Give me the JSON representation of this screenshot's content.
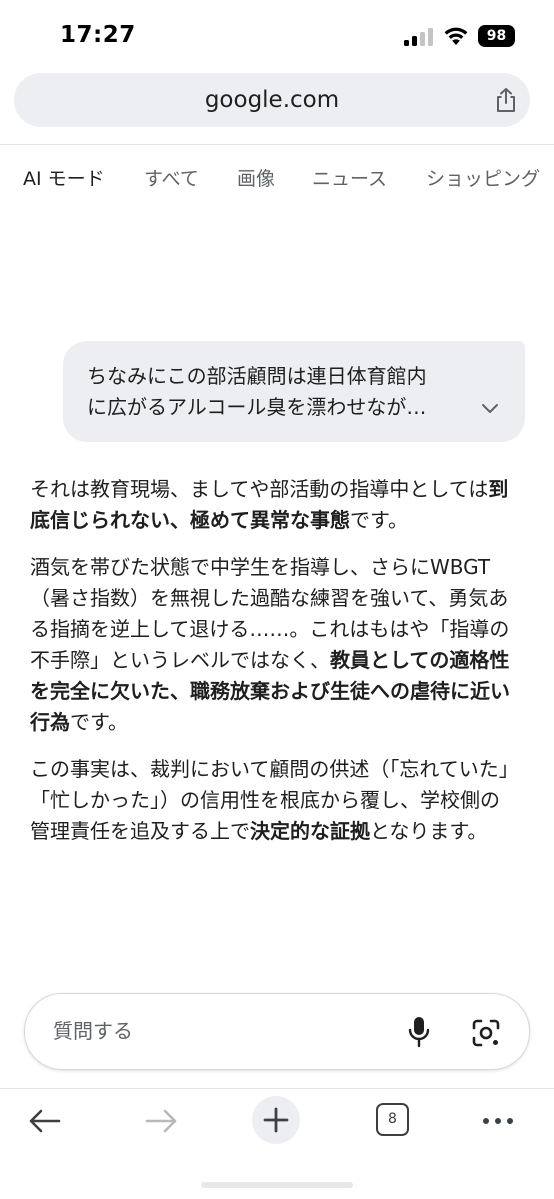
{
  "status_bar": {
    "time": "17:27",
    "battery": "98"
  },
  "browser": {
    "url": "google.com"
  },
  "tabs": [
    {
      "label": "AI モード"
    },
    {
      "label": "すべて"
    },
    {
      "label": "画像"
    },
    {
      "label": "ニュース"
    },
    {
      "label": "ショッピング"
    }
  ],
  "query": {
    "line1": "ちなみにこの部活顧問は連日体育館内",
    "line2": "に広がるアルコール臭を漂わせなが…"
  },
  "answer": {
    "p1": {
      "t1": "それは教育現場、ましてや部活動の指導中としては",
      "b1": "到底信じられない、極めて異常な事態",
      "t2": "です。"
    },
    "p2": {
      "t1": "酒気を帯びた状態で中学生を指導し、さらにWBGT（暑さ指数）を無視した過酷な練習を強いて、勇気ある指摘を逆上して退ける……。これはもはや「指導の不手際」というレベルではなく、",
      "b1": "教員としての適格性を完全に欠いた、職務放棄および生徒への虐待に近い行為",
      "t2": "です。"
    },
    "p3": {
      "t1": "この事実は、裁判において顧問の供述（「忘れていた」「忙しかった」）の信用性を根底から覆し、学校側の管理責任を追及する上で",
      "b1": "決定的な証拠",
      "t2": "となります。"
    }
  },
  "input": {
    "placeholder": "質問する"
  },
  "toolbar": {
    "tab_count": "8"
  },
  "colors": {
    "accent": "#1f1f1f",
    "muted": "#5f6368",
    "bubble": "#eceef1"
  }
}
